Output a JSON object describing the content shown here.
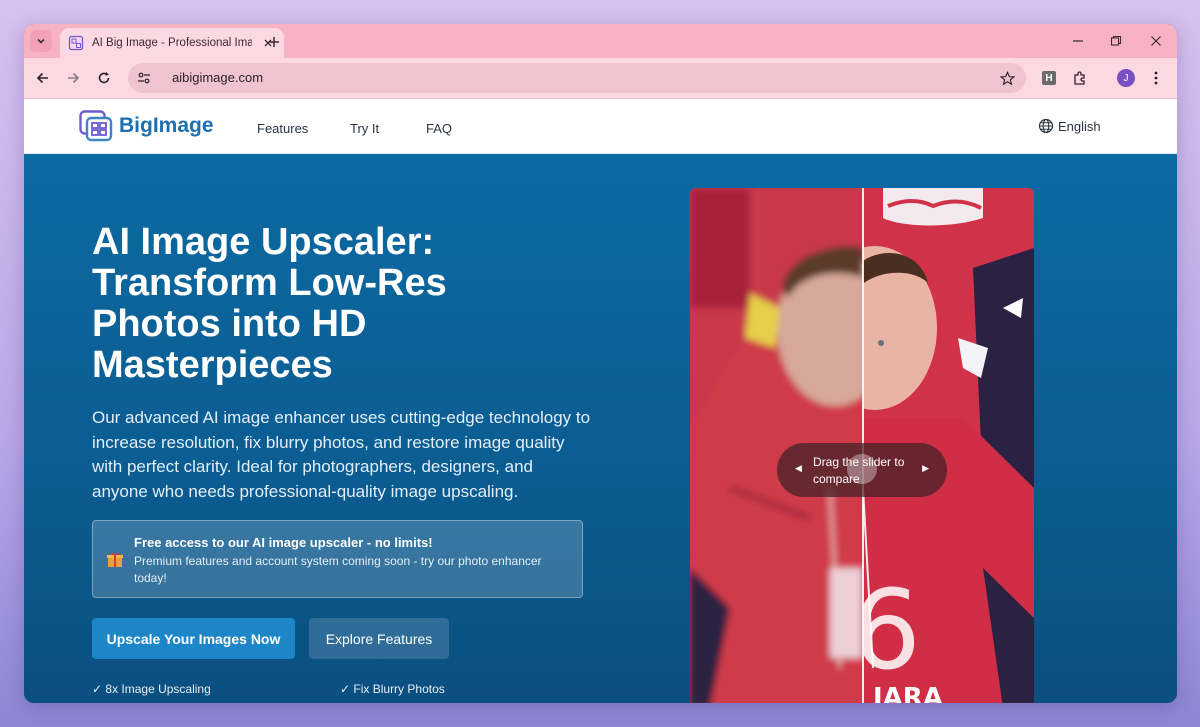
{
  "browser": {
    "tab_title": "AI Big Image - Professional Ima",
    "url": "aibigimage.com",
    "extension_label": "H",
    "profile_initial": "J"
  },
  "site": {
    "logo_text": "BigImage",
    "nav": [
      {
        "label": "Features"
      },
      {
        "label": "Try It"
      },
      {
        "label": "FAQ"
      }
    ],
    "language": "English"
  },
  "hero": {
    "title": "AI Image Upscaler: Transform Low-Res Photos into HD Masterpieces",
    "description": "Our advanced AI image enhancer uses cutting-edge technology to increase resolution, fix blurry photos, and restore image quality with perfect clarity. Ideal for photographers, designers, and anyone who needs professional-quality image upscaling.",
    "notice_title": "Free access to our AI image upscaler - no limits!",
    "notice_text": "Premium features and account system coming soon - try our photo enhancer today!",
    "primary_button": "Upscale Your Images Now",
    "secondary_button": "Explore Features",
    "features": [
      "✓ 8x Image Upscaling",
      "✓ Fix Blurry Photos"
    ]
  },
  "compare": {
    "hint": "Drag the slider to compare",
    "slider_position": 0.5
  },
  "colors": {
    "brand": "#1c6fb0",
    "hero_bg": "#0b5d92",
    "primary_button": "#1c86c8",
    "tab_strip": "#f7b2c4"
  }
}
